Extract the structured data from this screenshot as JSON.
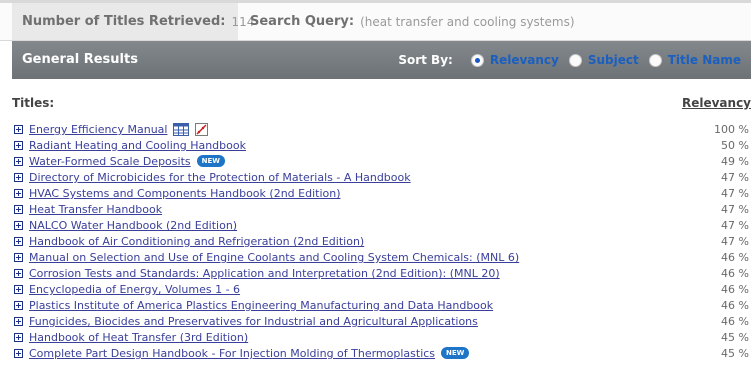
{
  "info": {
    "count_label": "Number of Titles Retrieved:",
    "count_value": "114",
    "query_label": "Search Query:",
    "query_value": "(heat transfer and cooling systems)"
  },
  "results": {
    "title": "General Results",
    "sort_label": "Sort By:",
    "sort_options": [
      "Relevancy",
      "Subject",
      "Title Name"
    ],
    "selected": "Relevancy"
  },
  "list": {
    "titles_header": "Titles:",
    "relevancy_header": "Relevancy",
    "badge_text": "NEW",
    "rows": [
      {
        "title": "Energy Efficiency Manual",
        "relevancy": "100 %",
        "icons": [
          "table-icon",
          "chart-icon"
        ]
      },
      {
        "title": "Radiant Heating and Cooling Handbook",
        "relevancy": "50 %"
      },
      {
        "title": "Water-Formed Scale Deposits",
        "relevancy": "49 %",
        "new": true
      },
      {
        "title": "Directory of Microbicides for the Protection of Materials - A Handbook",
        "relevancy": "47 %"
      },
      {
        "title": "HVAC Systems and Components Handbook (2nd Edition)",
        "relevancy": "47 %"
      },
      {
        "title": "Heat Transfer Handbook",
        "relevancy": "47 %"
      },
      {
        "title": "NALCO Water Handbook (2nd Edition)",
        "relevancy": "47 %"
      },
      {
        "title": "Handbook of Air Conditioning and Refrigeration (2nd Edition)",
        "relevancy": "47 %"
      },
      {
        "title": "Manual on Selection and Use of Engine Coolants and Cooling System Chemicals: (MNL 6)",
        "relevancy": "46 %"
      },
      {
        "title": "Corrosion Tests and Standards: Application and Interpretation (2nd Edition): (MNL 20)",
        "relevancy": "46 %"
      },
      {
        "title": "Encyclopedia of Energy, Volumes 1 - 6",
        "relevancy": "46 %"
      },
      {
        "title": "Plastics Institute of America Plastics Engineering Manufacturing and Data Handbook",
        "relevancy": "46 %"
      },
      {
        "title": "Fungicides, Biocides and Preservatives for Industrial and Agricultural Applications",
        "relevancy": "46 %"
      },
      {
        "title": "Handbook of Heat Transfer (3rd Edition)",
        "relevancy": "45 %"
      },
      {
        "title": "Complete Part Design Handbook - For Injection Molding of Thermoplastics",
        "relevancy": "45 %",
        "new": true
      }
    ]
  }
}
